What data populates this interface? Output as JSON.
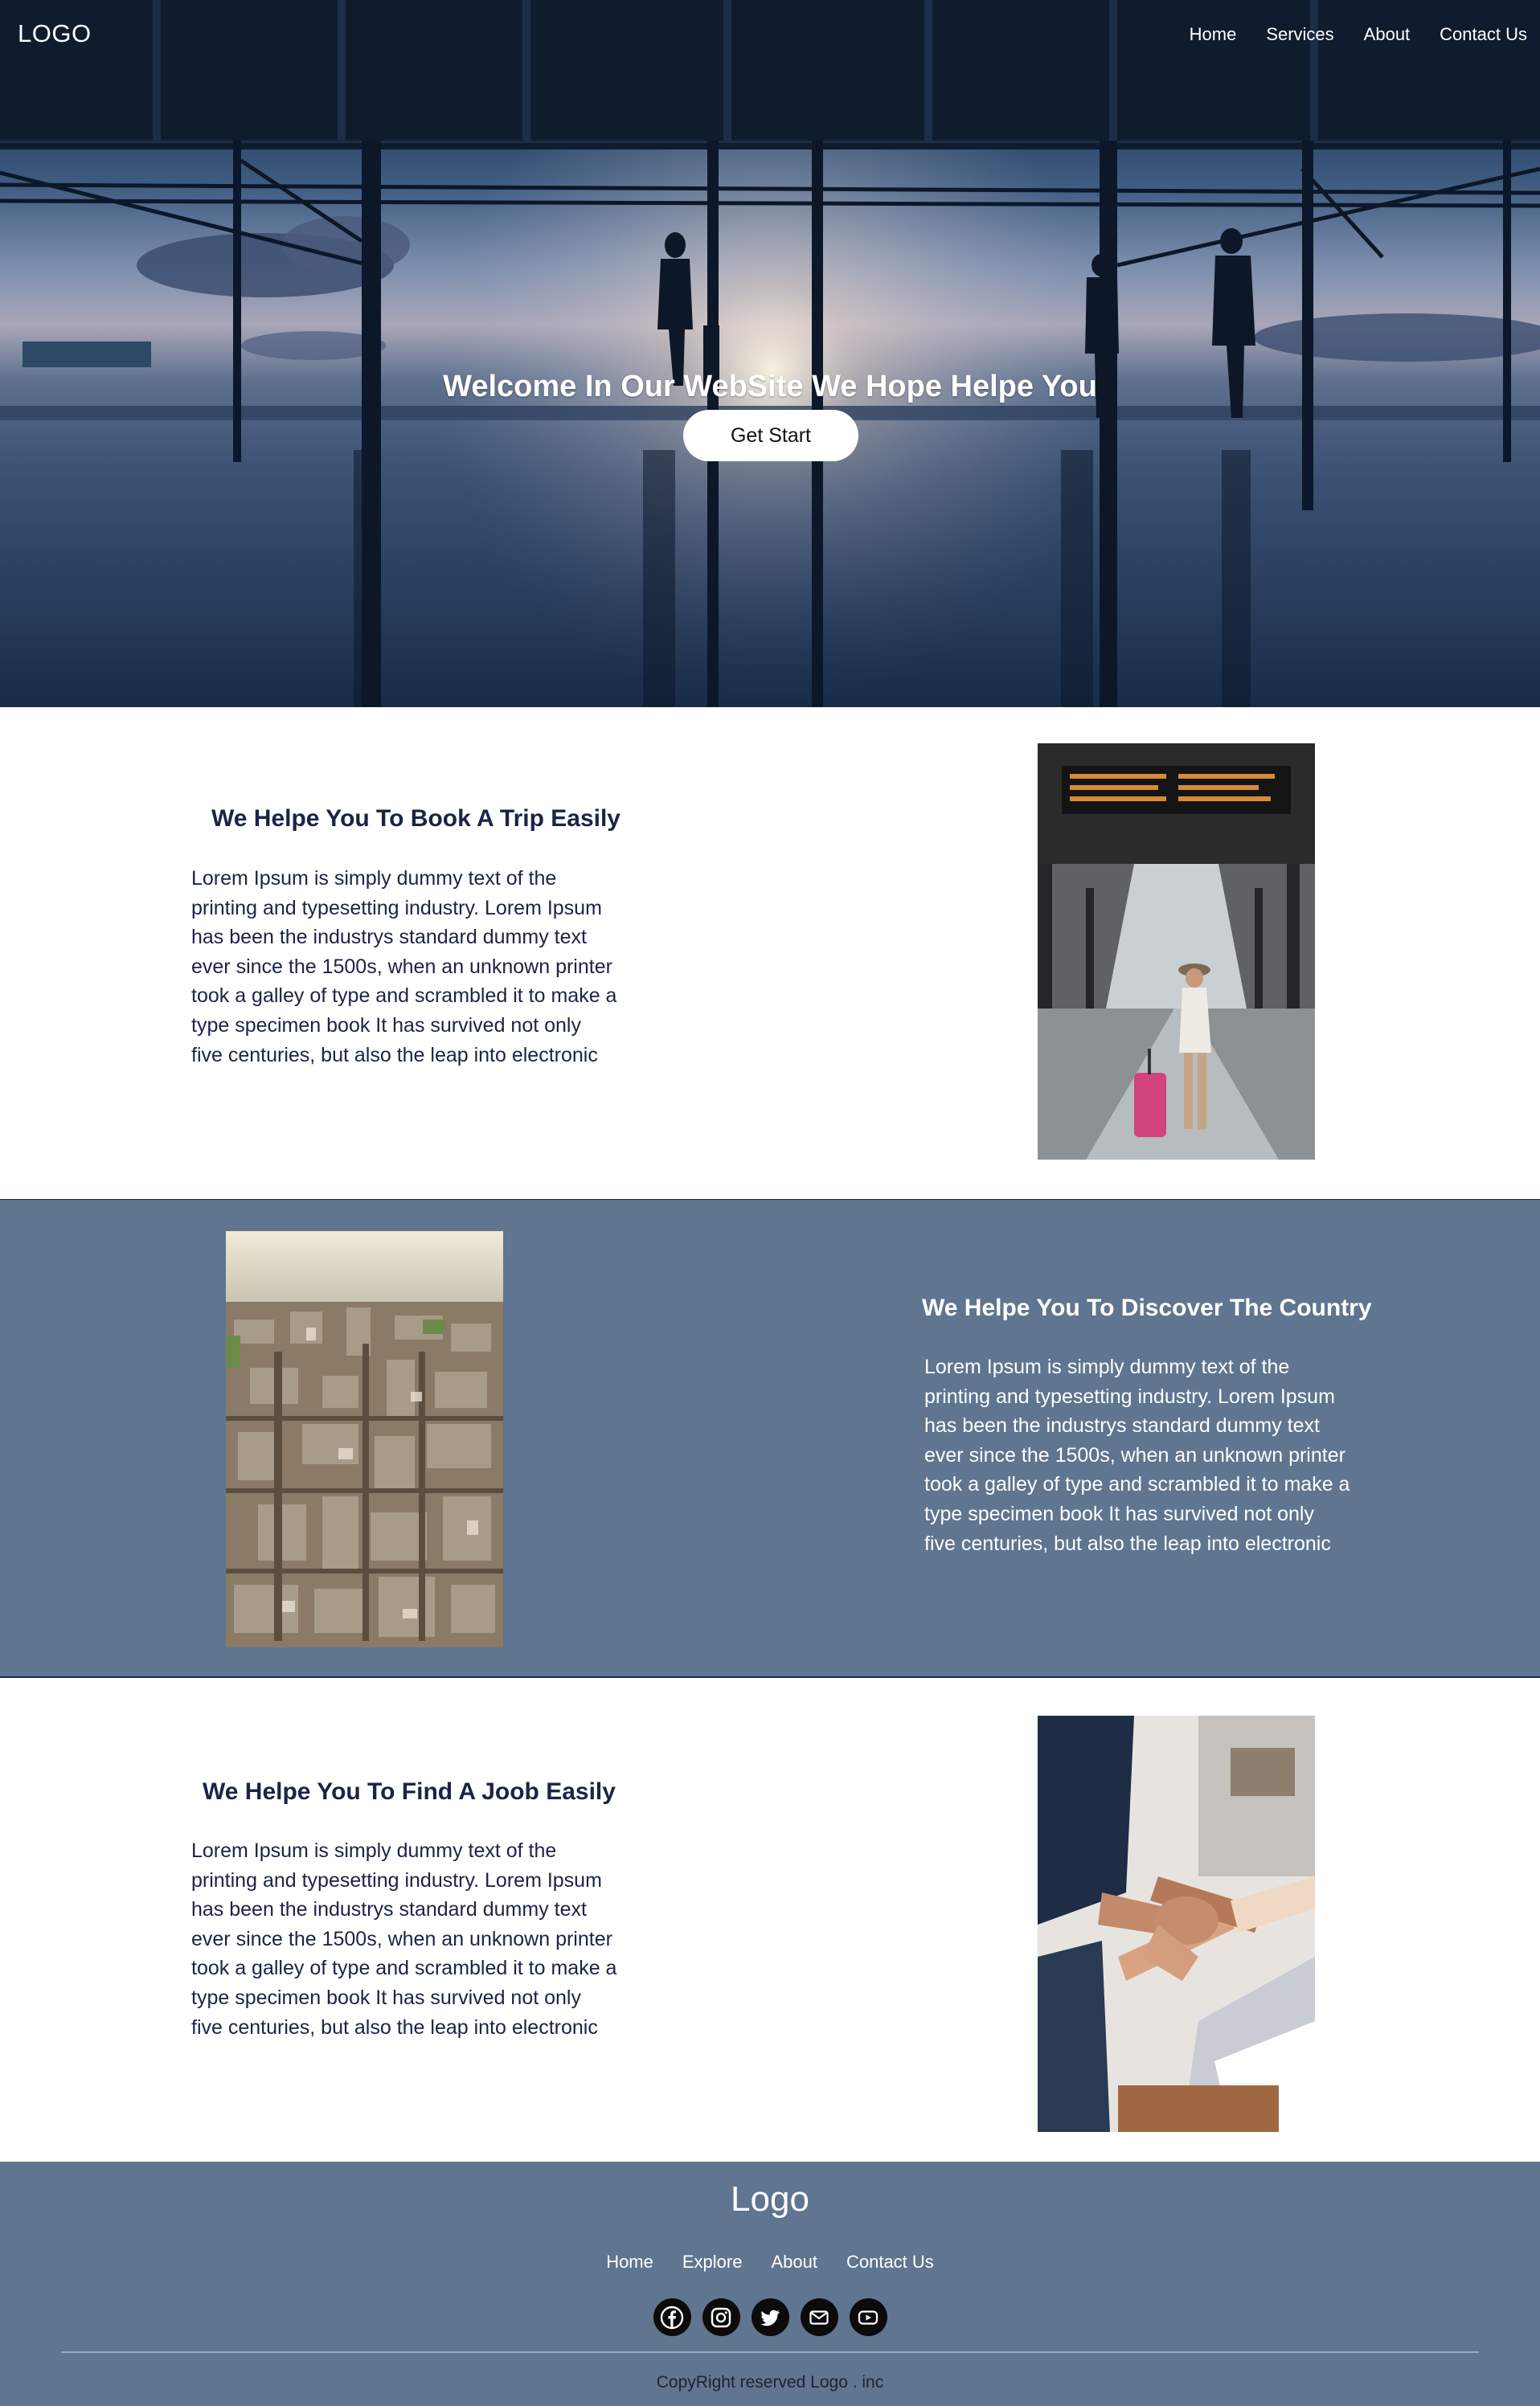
{
  "nav": {
    "logo": "LOGO",
    "links": [
      "Home",
      "Services",
      "About",
      "Contact Us"
    ]
  },
  "hero": {
    "title": "Welcome In Our WebSite We Hope Helpe You",
    "button": "Get Start"
  },
  "features": [
    {
      "heading": "We Helpe You To Book A Trip Easily",
      "text": "Lorem Ipsum is simply dummy text of the printing and typesetting industry. Lorem Ipsum has been the industrys standard dummy text ever since the 1500s, when an unknown printer took a galley of type and scrambled it to make a type specimen book It has survived not only five centuries, but also the leap into electronic"
    },
    {
      "heading": "We Helpe You To Discover The Country",
      "text": "Lorem Ipsum is simply dummy text of the printing and typesetting industry. Lorem Ipsum has been the industrys standard dummy text ever since the 1500s, when an unknown printer took a galley of type and scrambled it to make a type specimen book It has survived not only five centuries, but also the leap into electronic"
    },
    {
      "heading": "We Helpe You To Find A Joob Easily",
      "text": "Lorem Ipsum is simply dummy text of the printing and typesetting industry. Lorem Ipsum has been the industrys standard dummy text ever since the 1500s, when an unknown printer took a galley of type and scrambled it to make a type specimen book It has survived not only five centuries, but also the leap into electronic"
    }
  ],
  "footer": {
    "logo": "Logo",
    "links": [
      "Home",
      "Explore",
      "About",
      "Contact Us"
    ],
    "socials": [
      "facebook-icon",
      "instagram-icon",
      "twitter-icon",
      "mail-icon",
      "youtube-icon"
    ],
    "copyright": "CopyRight reserved Logo . inc"
  },
  "colors": {
    "section_blue": "#5f7590",
    "heading_navy": "#1c2347"
  }
}
